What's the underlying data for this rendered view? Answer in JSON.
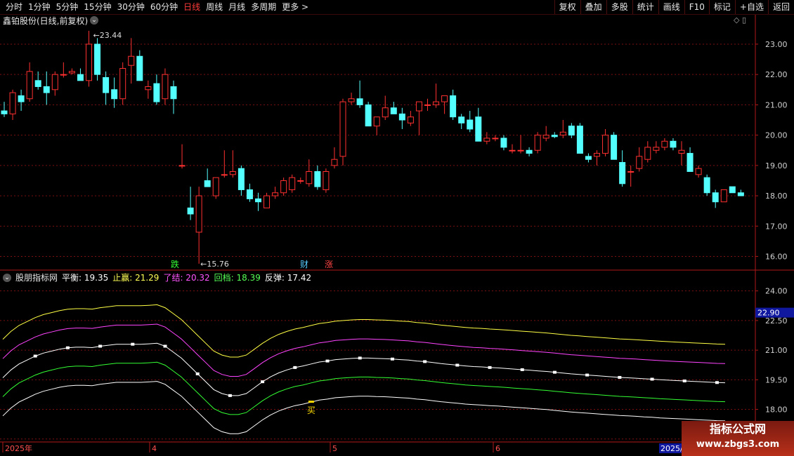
{
  "toolbar": {
    "periods": [
      "分时",
      "1分钟",
      "5分钟",
      "15分钟",
      "30分钟",
      "60分钟",
      "日线",
      "周线",
      "月线",
      "多周期",
      "更多 >"
    ],
    "active_period": "日线",
    "actions": [
      "复权",
      "叠加",
      "多股",
      "统计",
      "画线",
      "F10",
      "标记",
      "+自选",
      "返回"
    ]
  },
  "stock": {
    "title": "鑫铂股份(日线,前复权)"
  },
  "price_axis": [
    "23.00",
    "22.00",
    "21.00",
    "20.00",
    "19.00",
    "18.00",
    "17.00",
    "16.00"
  ],
  "price_range": [
    15.55,
    23.6
  ],
  "annotations": {
    "high_label": "23.44",
    "low_label": "15.76",
    "die": "跌",
    "cai": "财",
    "zhang": "涨"
  },
  "candles": [
    [
      20.8,
      21.1,
      20.6,
      20.7
    ],
    [
      20.7,
      21.5,
      20.5,
      21.4
    ],
    [
      21.3,
      21.5,
      20.8,
      21.1
    ],
    [
      21.2,
      22.4,
      21.1,
      22.1
    ],
    [
      21.8,
      22.1,
      21.5,
      21.6
    ],
    [
      21.6,
      22.1,
      21.0,
      21.4
    ],
    [
      21.5,
      22.1,
      21.3,
      22.0
    ],
    [
      22.0,
      22.4,
      21.9,
      22.0
    ],
    [
      22.05,
      22.2,
      22.0,
      22.1
    ],
    [
      22.0,
      22.2,
      21.8,
      21.8
    ],
    [
      21.8,
      23.44,
      21.6,
      23.0
    ],
    [
      23.0,
      23.2,
      21.8,
      22.0
    ],
    [
      21.9,
      22.1,
      21.0,
      21.4
    ],
    [
      21.5,
      21.9,
      20.9,
      21.2
    ],
    [
      21.2,
      22.4,
      21.0,
      22.2
    ],
    [
      22.3,
      23.2,
      21.7,
      22.6
    ],
    [
      22.6,
      22.8,
      21.8,
      21.8
    ],
    [
      21.5,
      21.8,
      21.2,
      21.6
    ],
    [
      21.7,
      22.0,
      21.0,
      21.1
    ],
    [
      21.2,
      22.2,
      21.0,
      22.0
    ],
    [
      21.6,
      21.8,
      20.7,
      21.2
    ],
    [
      19.0,
      19.7,
      18.9,
      19.0
    ],
    [
      17.6,
      18.3,
      17.2,
      17.4
    ],
    [
      16.8,
      18.3,
      15.76,
      18.0
    ],
    [
      18.5,
      18.9,
      18.3,
      18.3
    ],
    [
      18.0,
      18.6,
      17.9,
      18.6
    ],
    [
      18.7,
      19.5,
      18.6,
      18.7
    ],
    [
      18.7,
      19.5,
      18.6,
      18.8
    ],
    [
      18.9,
      19.0,
      18.0,
      18.2
    ],
    [
      18.2,
      18.4,
      17.8,
      17.9
    ],
    [
      17.9,
      18.1,
      17.5,
      17.8
    ],
    [
      17.6,
      18.1,
      17.6,
      18.0
    ],
    [
      18.0,
      18.3,
      17.9,
      18.1
    ],
    [
      18.1,
      18.6,
      18.0,
      18.5
    ],
    [
      18.2,
      18.7,
      18.1,
      18.6
    ],
    [
      18.5,
      18.6,
      18.4,
      18.5
    ],
    [
      18.4,
      19.2,
      18.3,
      18.8
    ],
    [
      18.8,
      19.0,
      18.2,
      18.3
    ],
    [
      18.2,
      18.9,
      18.1,
      18.8
    ],
    [
      19.0,
      19.6,
      18.9,
      19.2
    ],
    [
      19.3,
      21.2,
      19.0,
      21.1
    ],
    [
      21.1,
      21.4,
      21.0,
      21.2
    ],
    [
      21.2,
      21.8,
      20.9,
      21.0
    ],
    [
      21.0,
      21.1,
      20.3,
      20.3
    ],
    [
      20.3,
      20.6,
      20.0,
      20.6
    ],
    [
      20.6,
      21.3,
      20.5,
      20.9
    ],
    [
      20.9,
      21.1,
      20.7,
      20.7
    ],
    [
      20.7,
      20.9,
      20.2,
      20.5
    ],
    [
      20.4,
      20.8,
      20.3,
      20.6
    ],
    [
      20.8,
      21.1,
      20.0,
      21.1
    ],
    [
      21.0,
      21.2,
      20.8,
      21.0
    ],
    [
      21.0,
      21.7,
      20.9,
      21.1
    ],
    [
      21.1,
      21.3,
      20.7,
      21.3
    ],
    [
      21.3,
      21.5,
      20.5,
      20.6
    ],
    [
      20.6,
      20.7,
      20.2,
      20.4
    ],
    [
      20.5,
      20.8,
      20.1,
      20.2
    ],
    [
      20.6,
      20.9,
      19.8,
      19.8
    ],
    [
      19.8,
      20.1,
      19.7,
      19.9
    ],
    [
      19.9,
      20.0,
      19.8,
      19.9
    ],
    [
      19.9,
      20.0,
      19.5,
      19.6
    ],
    [
      19.5,
      19.7,
      19.4,
      19.5
    ],
    [
      19.5,
      20.0,
      19.4,
      19.5
    ],
    [
      19.5,
      19.6,
      19.3,
      19.4
    ],
    [
      19.5,
      20.1,
      19.4,
      20.0
    ],
    [
      19.9,
      20.3,
      19.8,
      20.0
    ],
    [
      20.0,
      20.1,
      19.9,
      19.95
    ],
    [
      20.0,
      20.5,
      19.9,
      20.1
    ],
    [
      20.3,
      20.4,
      19.9,
      20.0
    ],
    [
      20.3,
      20.4,
      19.9,
      19.4
    ],
    [
      19.3,
      19.4,
      19.1,
      19.2
    ],
    [
      19.3,
      19.5,
      19.0,
      19.4
    ],
    [
      19.4,
      20.2,
      19.3,
      20.0
    ],
    [
      20.0,
      20.1,
      19.2,
      19.2
    ],
    [
      19.1,
      19.5,
      18.3,
      18.4
    ],
    [
      18.8,
      19.0,
      18.3,
      18.8
    ],
    [
      18.9,
      19.6,
      18.8,
      19.3
    ],
    [
      19.2,
      19.8,
      19.1,
      19.6
    ],
    [
      19.5,
      19.8,
      19.4,
      19.6
    ],
    [
      19.6,
      19.9,
      19.5,
      19.8
    ],
    [
      19.8,
      19.9,
      19.5,
      19.6
    ],
    [
      19.4,
      19.8,
      19.0,
      19.5
    ],
    [
      19.4,
      19.6,
      18.8,
      18.8
    ],
    [
      18.7,
      19.0,
      18.6,
      18.9
    ],
    [
      18.6,
      18.7,
      18.0,
      18.1
    ],
    [
      18.1,
      18.2,
      17.6,
      17.8
    ],
    [
      17.8,
      18.2,
      17.8,
      18.2
    ],
    [
      18.3,
      18.3,
      18.1,
      18.1
    ],
    [
      18.1,
      18.2,
      18.0,
      18.0
    ]
  ],
  "indicator": {
    "name": "股朋指标网",
    "labels": [
      {
        "text": "平衡: 19.35",
        "color": "#ffffff"
      },
      {
        "text": "止赢: 21.29",
        "color": "#ffff55"
      },
      {
        "text": "了结: 20.32",
        "color": "#ff55ff"
      },
      {
        "text": "回档: 18.39",
        "color": "#55ff55"
      },
      {
        "text": "反弹: 17.42",
        "color": "#ffffff"
      }
    ],
    "axis": [
      "24.00",
      "22.50",
      "21.00",
      "19.50",
      "18.00",
      "16.50"
    ],
    "range": [
      16.35,
      24.45
    ],
    "current_tag": "22.90",
    "buy_label": "买",
    "mid_values": [
      19.6,
      20.0,
      20.3,
      20.5,
      20.7,
      20.85,
      20.95,
      21.05,
      21.12,
      21.15,
      21.15,
      21.13,
      21.2,
      21.25,
      21.3,
      21.3,
      21.3,
      21.3,
      21.32,
      21.35,
      21.2,
      20.9,
      20.6,
      20.2,
      19.8,
      19.4,
      19.0,
      18.8,
      18.7,
      18.7,
      18.8,
      19.1,
      19.4,
      19.65,
      19.85,
      20.0,
      20.12,
      20.2,
      20.3,
      20.4,
      20.45,
      20.52,
      20.55,
      20.58,
      20.6,
      20.6,
      20.58,
      20.57,
      20.55,
      20.52,
      20.5,
      20.45,
      20.42,
      20.37,
      20.32,
      20.28,
      20.24,
      20.2,
      20.17,
      20.15,
      20.12,
      20.1,
      20.07,
      20.04,
      20.01,
      19.98,
      19.95,
      19.92,
      19.88,
      19.84,
      19.8,
      19.77,
      19.74,
      19.71,
      19.68,
      19.65,
      19.62,
      19.6,
      19.58,
      19.55,
      19.53,
      19.5,
      19.48,
      19.46,
      19.44,
      19.42,
      19.4,
      19.38,
      19.36,
      19.35
    ],
    "offsets": {
      "top": 1.95,
      "upper": 0.97,
      "lower": -0.96,
      "bottom": -1.93
    },
    "buy_index": 38
  },
  "time_axis": [
    "2025年",
    "4",
    "5",
    "6"
  ],
  "time_tag": "2025/",
  "colors": {
    "up": "#ff3030",
    "down": "#54ffff",
    "grid": "#7a1010",
    "axis": "#b01818",
    "top": "#ffff44",
    "upper": "#ff44ff",
    "mid": "#ffffff",
    "lower": "#33ff33",
    "bottom": "#ffffff"
  },
  "watermark": {
    "line1": "指标公式网",
    "line2": "www.zbgs3.com"
  }
}
